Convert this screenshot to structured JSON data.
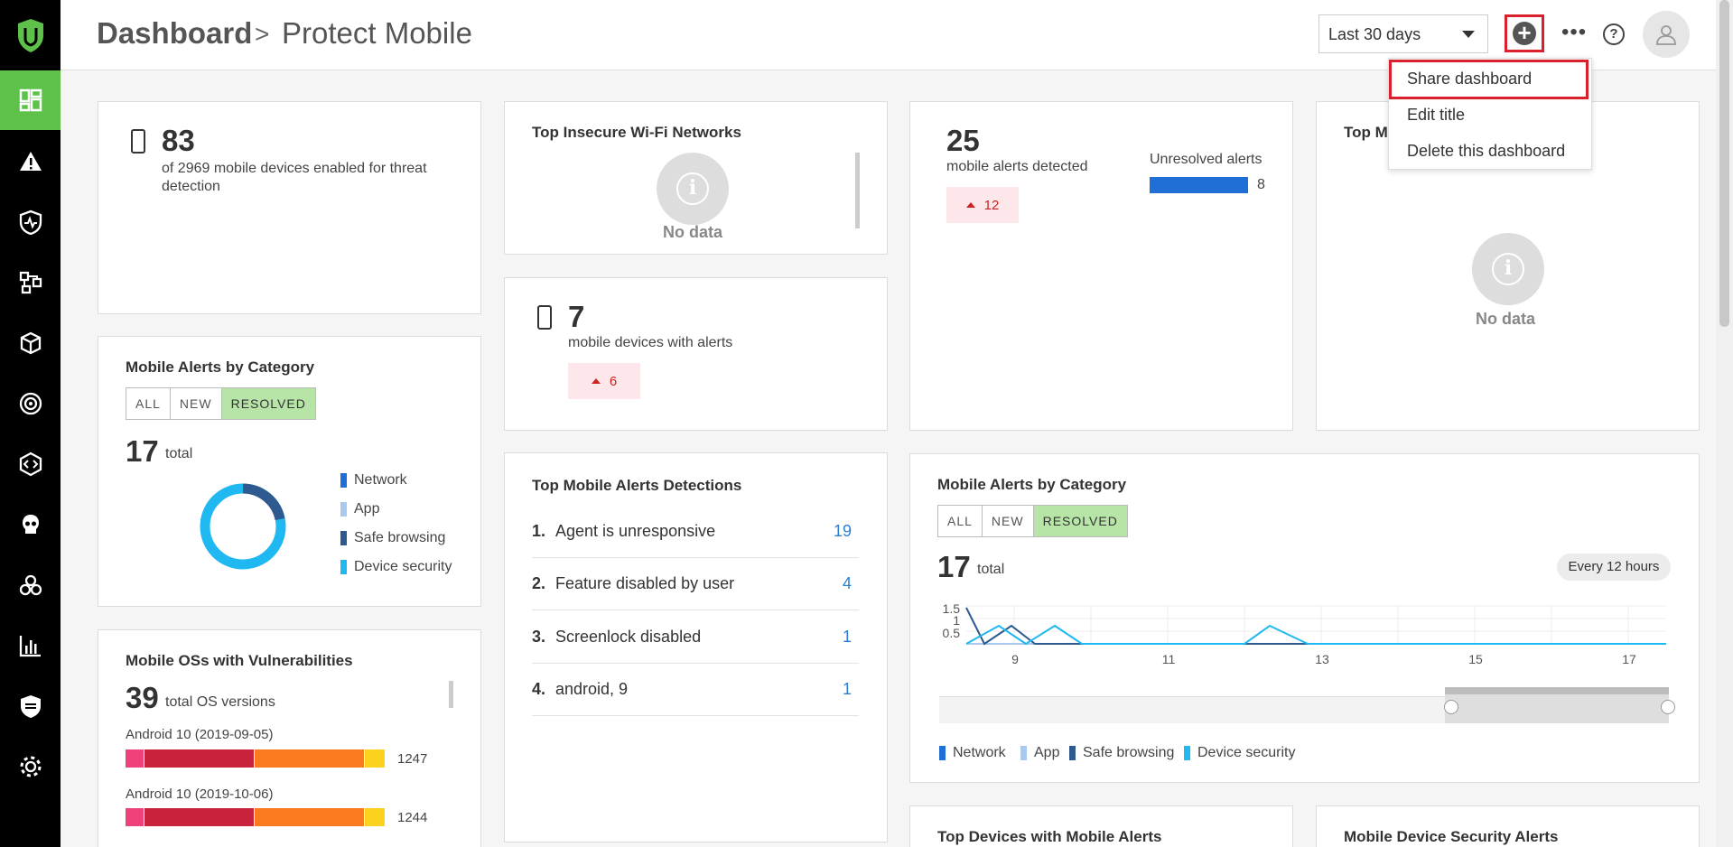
{
  "header": {
    "breadcrumb_root": "Dashboard",
    "breadcrumb_sep": ">",
    "page_title": "Protect Mobile",
    "range": "Last 30 days",
    "more": "•••"
  },
  "menu": {
    "items": [
      "Share dashboard",
      "Edit title",
      "Delete this dashboard"
    ]
  },
  "devices_card": {
    "count": "83",
    "text": "of 2969 mobile devices enabled for threat detection"
  },
  "wifi_card": {
    "title": "Top Insecure Wi-Fi Networks",
    "no_data": "No data"
  },
  "alert_devices_card": {
    "count": "7",
    "text": "mobile devices with alerts",
    "trend": "6"
  },
  "alerts_detected_card": {
    "count": "25",
    "text": "mobile alerts detected",
    "trend": "12",
    "unresolved_label": "Unresolved alerts",
    "unresolved_value": "8"
  },
  "top_ma_card": {
    "title": "Top Ma",
    "no_data": "No data"
  },
  "category_small": {
    "title": "Mobile Alerts by Category",
    "tabs": [
      "ALL",
      "NEW",
      "RESOLVED"
    ],
    "total": "17",
    "total_label": "total",
    "legend": [
      "Network",
      "App",
      "Safe browsing",
      "Device security"
    ]
  },
  "detections_card": {
    "title": "Top Mobile Alerts Detections",
    "rows": [
      {
        "n": "1.",
        "label": "Agent is unresponsive",
        "count": "19"
      },
      {
        "n": "2.",
        "label": "Feature disabled by user",
        "count": "4"
      },
      {
        "n": "3.",
        "label": "Screenlock disabled",
        "count": "1"
      },
      {
        "n": "4.",
        "label": "android, 9",
        "count": "1"
      }
    ]
  },
  "category_big": {
    "title": "Mobile Alerts by Category",
    "tabs": [
      "ALL",
      "NEW",
      "RESOLVED"
    ],
    "total": "17",
    "total_label": "total",
    "badge": "Every 12 hours",
    "y_ticks": [
      "1.5",
      "1",
      "0.5"
    ],
    "x_ticks": [
      "9",
      "11",
      "13",
      "15",
      "17"
    ],
    "legend": [
      "Network",
      "App",
      "Safe browsing",
      "Device security"
    ]
  },
  "os_card": {
    "title": "Mobile OSs with Vulnerabilities",
    "total": "39",
    "total_label": "total OS versions",
    "rows": [
      {
        "label": "Android 10 (2019-09-05)",
        "value": "1247"
      },
      {
        "label": "Android 10 (2019-10-06)",
        "value": "1244"
      }
    ]
  },
  "bottom_cards": {
    "left_title": "Top Devices with Mobile Alerts",
    "right_title": "Mobile Device Security Alerts"
  },
  "colors": {
    "accent": "#5ec24a",
    "network": "#1f6fd6",
    "app": "#a8c8ee",
    "safe_browsing": "#2f5a8f",
    "device_security": "#1fb8f0",
    "alert_red": "#d9202c"
  }
}
